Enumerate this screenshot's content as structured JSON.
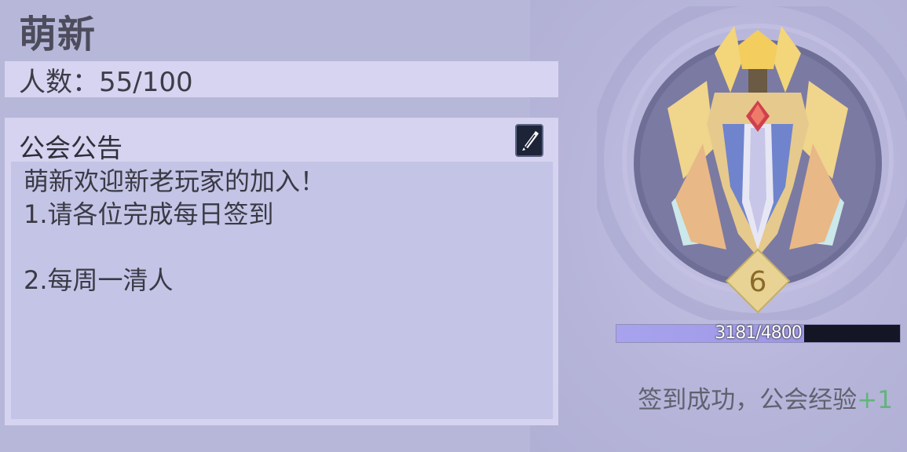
{
  "guild": {
    "name": "萌新",
    "members_label": "人数：55/100"
  },
  "notice": {
    "title": "公会公告",
    "lines": [
      "萌新欢迎新老玩家的加入！",
      "1.请各位完成每日签到",
      "",
      "2.每周一清人"
    ]
  },
  "emblem": {
    "level": "6"
  },
  "experience": {
    "current": 3181,
    "max": 4800,
    "text": "3181/4800",
    "fill_fraction": 0.6627
  },
  "checkin": {
    "message": "签到成功，公会经验",
    "bonus": "+1"
  },
  "colors": {
    "background": "#b7b7d9",
    "panel": "#d5d3ef",
    "exp_fill": "#a8a3ee",
    "exp_track": "#141625",
    "bonus_green": "#62b47c"
  }
}
